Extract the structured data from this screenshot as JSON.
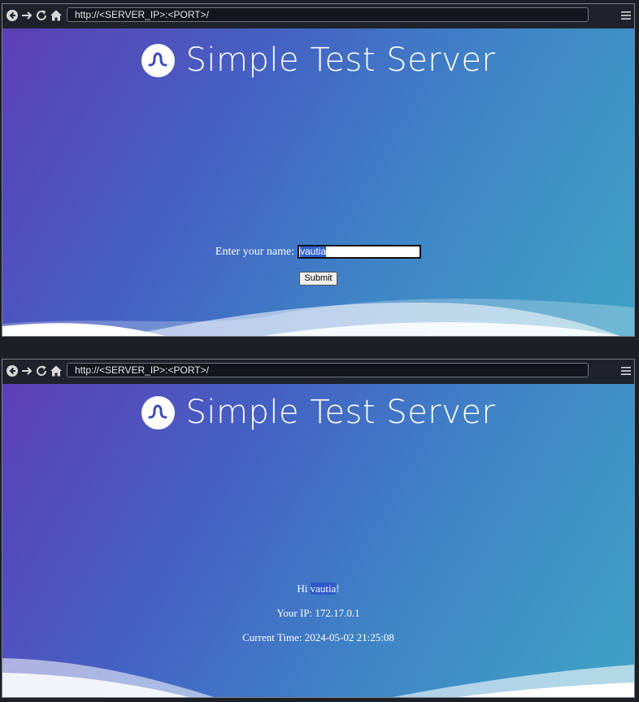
{
  "browser1": {
    "url": "http://<SERVER_IP>:<PORT>/"
  },
  "browser2": {
    "url": "http://<SERVER_IP>:<PORT>/"
  },
  "site": {
    "title": "Simple Test Server"
  },
  "form": {
    "label": "Enter your name:",
    "name_value": "vautia",
    "submit_label": "Submit"
  },
  "result": {
    "hi_prefix": "Hi ",
    "name": "vautia",
    "hi_suffix": "!",
    "ip_line": "Your IP: 172.17.0.1",
    "time_line": "Current Time: 2024-05-02 21:25:08"
  },
  "icons": [
    "back-icon",
    "forward-icon",
    "reload-icon",
    "home-icon",
    "hamburger-menu-icon",
    "logo-icon"
  ],
  "colors": {
    "gradient_start": "#5d3fb6",
    "gradient_end": "#3fa2c4",
    "selection": "#3164cf",
    "toolbar": "#1e222b"
  }
}
